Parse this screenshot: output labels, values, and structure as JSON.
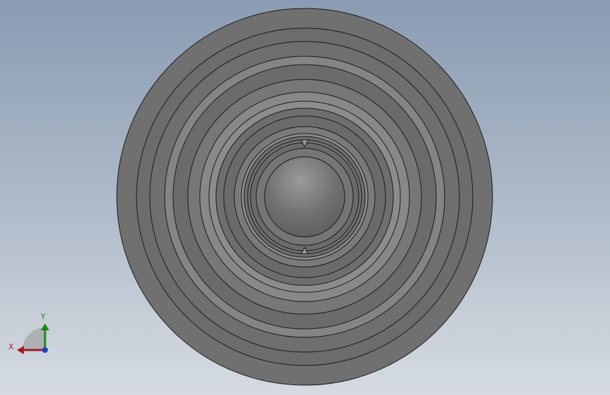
{
  "triad": {
    "x_label": "X",
    "y_label": "Y",
    "x_color": "#b22222",
    "y_color": "#1a8a1a",
    "z_color": "#1f3fbf"
  },
  "model": {
    "base_color": "#6e6e6e",
    "edge_color": "#1a1a1a",
    "highlight_color": "#8a8a8a",
    "dome_color": "#7a7a7a"
  }
}
